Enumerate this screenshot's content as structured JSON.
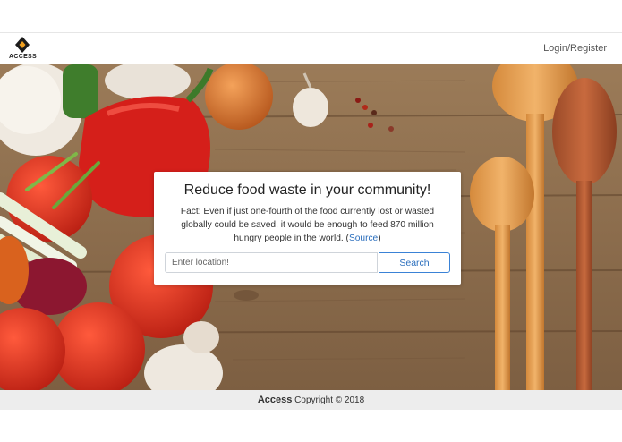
{
  "navbar": {
    "brand_name": "ACCESS",
    "login_label": "Login/Register"
  },
  "hero": {
    "title": "Reduce food waste in your community!",
    "fact_text": "Fact: Even if just one-fourth of the food currently lost or wasted globally could be saved, it would be enough to feed 870 million hungry people in the world. (",
    "source_link": "Source",
    "fact_close": ")",
    "search": {
      "placeholder": "Enter location!",
      "value": "",
      "button_label": "Search"
    }
  },
  "footer": {
    "brand": "Access",
    "copyright": "Copyright © 2018"
  },
  "colors": {
    "accent": "#2a6ebd",
    "brand_orange": "#f0a020",
    "wood": "#8a6a4a"
  },
  "icons": {
    "brand_logo": "diamond-logo-icon"
  }
}
